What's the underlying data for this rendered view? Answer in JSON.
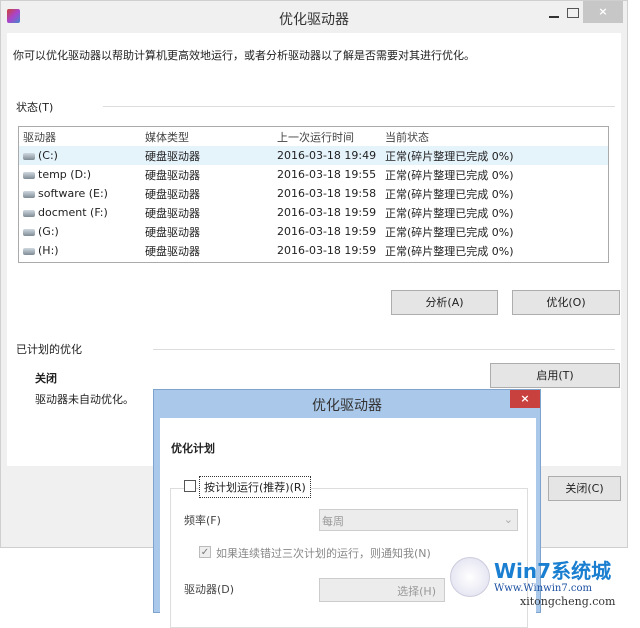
{
  "window": {
    "title": "优化驱动器",
    "description": "你可以优化驱动器以帮助计算机更高效地运行，或者分析驱动器以了解是否需要对其进行优化。"
  },
  "status": {
    "label": "状态(T)",
    "columns": [
      "驱动器",
      "媒体类型",
      "上一次运行时间",
      "当前状态"
    ],
    "rows": [
      {
        "drive": "(C:)",
        "media": "硬盘驱动器",
        "last": "2016-03-18 19:49",
        "state": "正常(碎片整理已完成 0%)"
      },
      {
        "drive": "temp (D:)",
        "media": "硬盘驱动器",
        "last": "2016-03-18 19:55",
        "state": "正常(碎片整理已完成 0%)"
      },
      {
        "drive": "software (E:)",
        "media": "硬盘驱动器",
        "last": "2016-03-18 19:58",
        "state": "正常(碎片整理已完成 0%)"
      },
      {
        "drive": "docment (F:)",
        "media": "硬盘驱动器",
        "last": "2016-03-18 19:59",
        "state": "正常(碎片整理已完成 0%)"
      },
      {
        "drive": "(G:)",
        "media": "硬盘驱动器",
        "last": "2016-03-18 19:59",
        "state": "正常(碎片整理已完成 0%)"
      },
      {
        "drive": "(H:)",
        "media": "硬盘驱动器",
        "last": "2016-03-18 19:59",
        "state": "正常(碎片整理已完成 0%)"
      }
    ],
    "analyze": "分析(A)",
    "optimize": "优化(O)"
  },
  "scheduled": {
    "label": "已计划的优化",
    "state": "关闭",
    "desc": "驱动器未自动优化。",
    "enable": "启用(T)"
  },
  "close": "关闭(C)",
  "dialog": {
    "title": "优化驱动器",
    "heading": "优化计划",
    "run_on_schedule": "按计划运行(推荐)(R)",
    "frequency_label": "频率(F)",
    "frequency_value": "每周",
    "notify": "如果连续错过三次计划的运行，则通知我(N)",
    "drives_label": "驱动器(D)",
    "choose": "选择(H)"
  },
  "watermark": {
    "brand": "Win7系统城",
    "url1": "Www.Winwin7.com",
    "url2": "xitongcheng.com"
  }
}
